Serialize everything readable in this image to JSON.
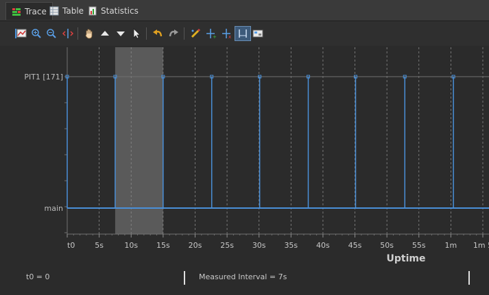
{
  "tabs": [
    {
      "label": "Trace",
      "icon": "trace-icon",
      "active": true
    },
    {
      "label": "Table",
      "icon": "table-icon",
      "active": false
    },
    {
      "label": "Statistics",
      "icon": "statistics-icon",
      "active": false
    }
  ],
  "toolbar": {
    "buttons": [
      {
        "name": "zoom-fit-icon"
      },
      {
        "name": "zoom-in-icon"
      },
      {
        "name": "zoom-out-icon"
      },
      {
        "name": "split-icon"
      },
      {
        "name": "hand-icon"
      },
      {
        "name": "arrow-up-icon"
      },
      {
        "name": "arrow-down-icon"
      },
      {
        "name": "pointer-icon"
      },
      {
        "name": "undo-icon"
      },
      {
        "name": "redo-icon"
      },
      {
        "name": "marker-pen-icon"
      },
      {
        "name": "add-marker-icon"
      },
      {
        "name": "remove-marker-icon"
      },
      {
        "name": "measure-interval-icon"
      },
      {
        "name": "settings-icon"
      }
    ]
  },
  "chart_data": {
    "type": "line",
    "xlabel": "Uptime",
    "x_tick_labels": [
      "t0",
      "5s",
      "10s",
      "15s",
      "20s",
      "25s",
      "30s",
      "35s",
      "40s",
      "45s",
      "50s",
      "55s",
      "1m",
      "1m 5"
    ],
    "x_tick_values": [
      0,
      5,
      10,
      15,
      20,
      25,
      30,
      35,
      40,
      45,
      50,
      55,
      60,
      65
    ],
    "xlim": [
      0,
      65
    ],
    "rows": [
      "PIT1 [171]",
      "main"
    ],
    "series": [
      {
        "name": "PIT1 [171]",
        "event_times": [
          0,
          7.5,
          15,
          22.6,
          30.1,
          37.7,
          45.1,
          52.8,
          60.4
        ]
      }
    ],
    "highlight_interval": [
      7.5,
      15
    ],
    "colors": {
      "trace": "#4a90d9",
      "highlight": "#5a5a5a",
      "grid": "#8a8a8a",
      "background": "#2b2b2b"
    }
  },
  "status": {
    "t0": "t0 = 0",
    "measured": "Measured Interval = 7s"
  }
}
